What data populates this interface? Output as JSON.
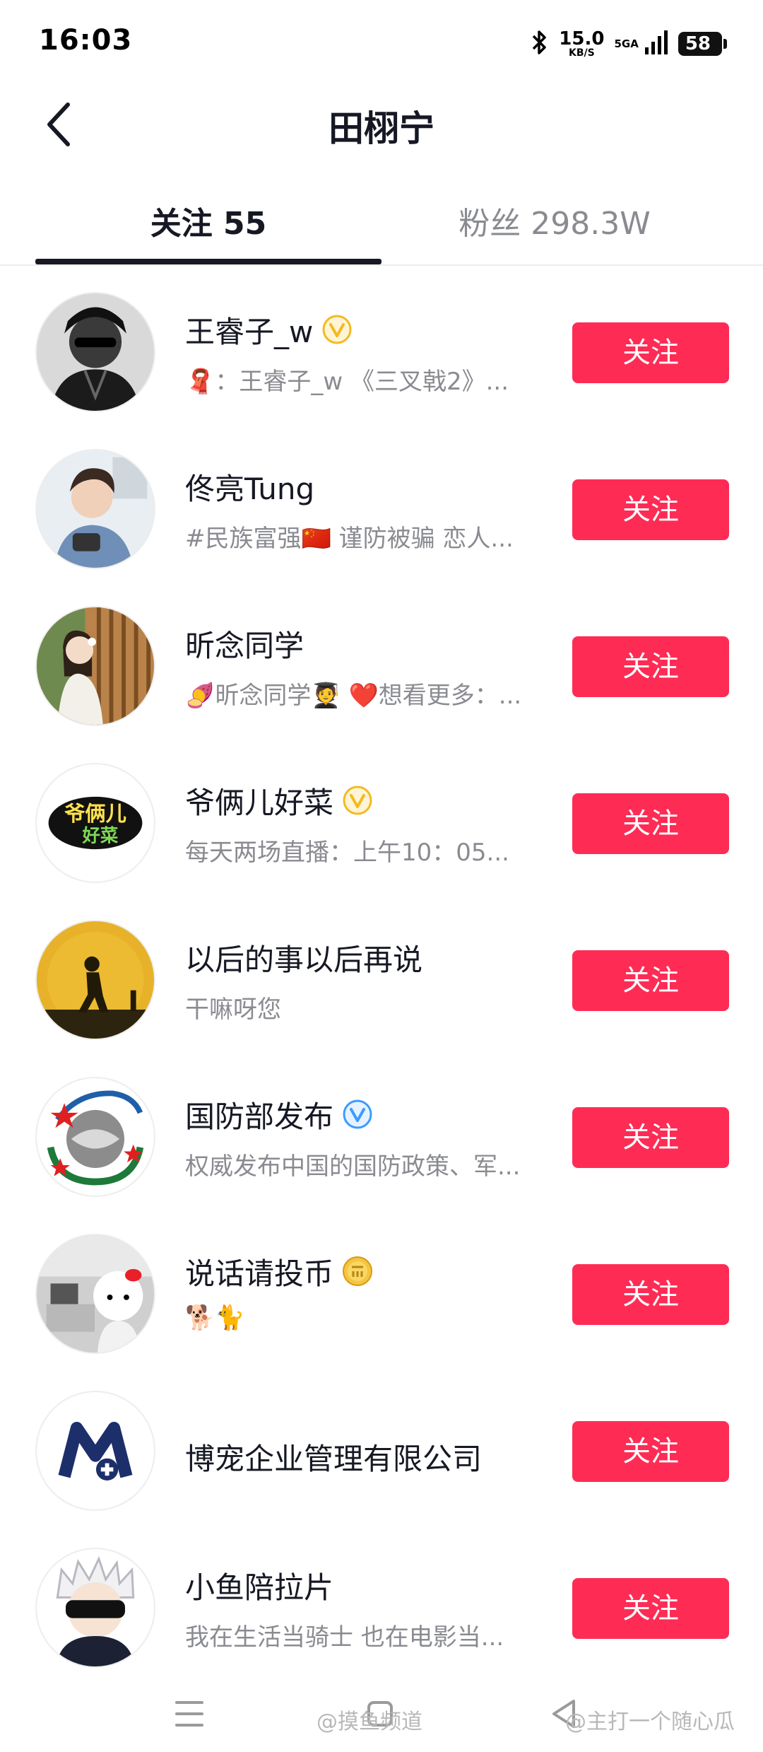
{
  "status_bar": {
    "time": "16:03",
    "speed_value": "15.0",
    "speed_unit": "KB/S",
    "network": "5GA",
    "battery": "58"
  },
  "header": {
    "title": "田栩宁",
    "back_icon": "chevron-left-icon"
  },
  "tabs": {
    "following": "关注 55",
    "fans": "粉丝 298.3W"
  },
  "follow_label": "关注",
  "users": [
    {
      "name": "王睿子_w",
      "badge": "yellow-verified",
      "desc": "🧣：王睿子_w 《三叉戟2》..."
    },
    {
      "name": "佟亮Tung",
      "badge": "",
      "desc": "#民族富强🇨🇳 谨防被骗 恋人..."
    },
    {
      "name": "昕念同学",
      "badge": "",
      "desc": "🍠昕念同学🧑‍🎓 ❤️想看更多：..."
    },
    {
      "name": "爷俩儿好菜",
      "badge": "yellow-verified",
      "desc": "每天两场直播：上午10：05..."
    },
    {
      "name": "以后的事以后再说",
      "badge": "",
      "desc": "干嘛呀您"
    },
    {
      "name": "国防部发布",
      "badge": "blue-verified",
      "desc": "权威发布中国的国防政策、军..."
    },
    {
      "name": "说话请投币",
      "badge": "coin",
      "desc": "🐕🐈"
    },
    {
      "name": "博宠企业管理有限公司",
      "badge": "",
      "desc": ""
    },
    {
      "name": "小鱼陪拉片",
      "badge": "",
      "desc": "我在生活当骑士 也在电影当..."
    }
  ],
  "avatar_logo_text": "爷俩儿 好菜",
  "watermarks": {
    "left": "@摸鱼频道",
    "right": "@主打一个随心瓜"
  },
  "colors": {
    "accent": "#fe2c55",
    "text_primary": "#161823",
    "text_secondary": "#8a8b91"
  }
}
